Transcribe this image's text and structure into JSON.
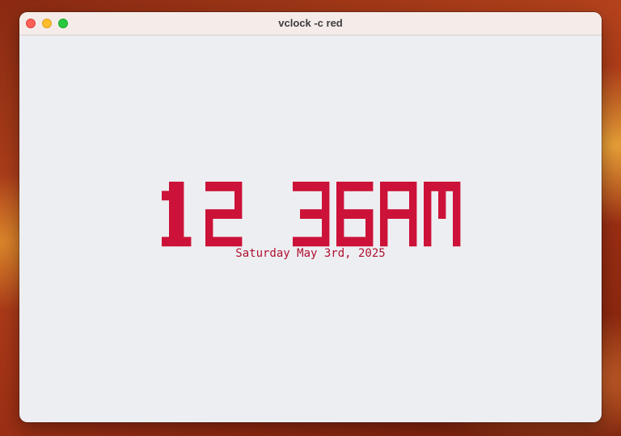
{
  "window": {
    "title": "vclock -c red"
  },
  "clock": {
    "time": "12 36AM",
    "date": "Saturday May 3rd, 2025",
    "color": "#cc1238"
  },
  "icons": {
    "close": "close-traffic-light-icon",
    "minimize": "minimize-traffic-light-icon",
    "maximize": "maximize-traffic-light-icon"
  }
}
